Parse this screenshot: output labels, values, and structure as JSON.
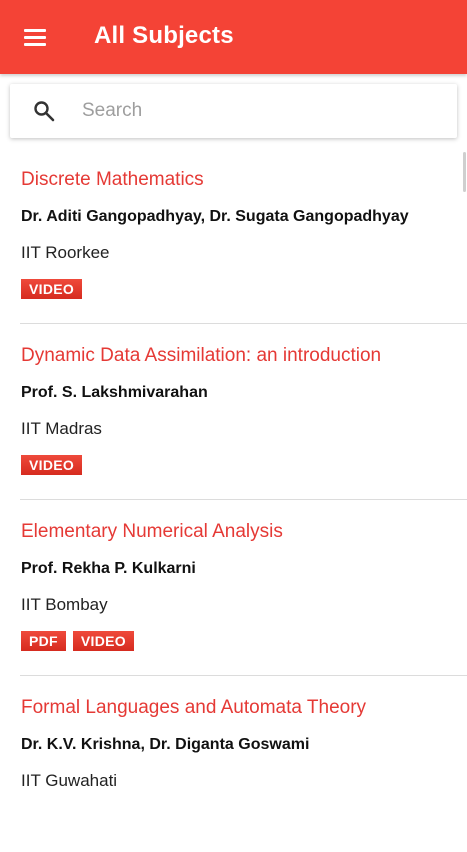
{
  "app_bar": {
    "title": "All Subjects"
  },
  "search": {
    "placeholder": "Search",
    "value": ""
  },
  "courses": [
    {
      "title": "Discrete Mathematics",
      "professors": "Dr. Aditi Gangopadhyay, Dr. Sugata Gangopadhyay",
      "institute": "IIT Roorkee",
      "badges": [
        "VIDEO"
      ]
    },
    {
      "title": "Dynamic Data Assimilation: an introduction",
      "professors": "Prof. S. Lakshmivarahan",
      "institute": "IIT Madras",
      "badges": [
        "VIDEO"
      ]
    },
    {
      "title": "Elementary Numerical Analysis",
      "professors": "Prof. Rekha P. Kulkarni",
      "institute": "IIT Bombay",
      "badges": [
        "PDF",
        "VIDEO"
      ]
    },
    {
      "title": "Formal Languages and Automata Theory",
      "professors": "Dr. K.V. Krishna, Dr. Diganta Goswami",
      "institute": "IIT Guwahati",
      "badges": []
    }
  ],
  "colors": {
    "accent": "#f44336",
    "title_red": "#e53935",
    "badge_red": "#e53a2c"
  },
  "icons": {
    "menu": "menu-icon",
    "search": "search-icon"
  }
}
